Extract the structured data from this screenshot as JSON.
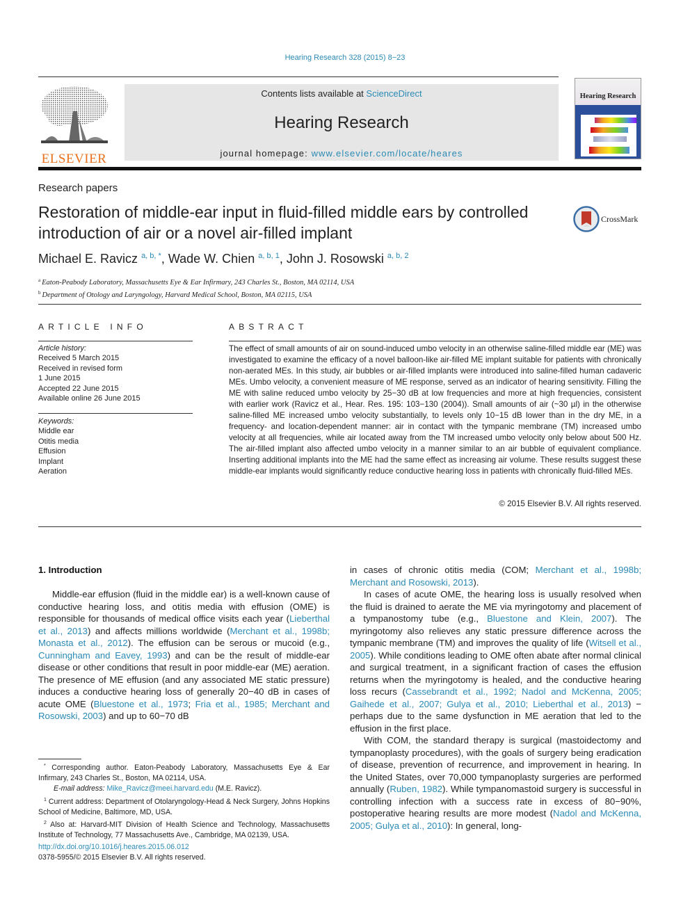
{
  "header": {
    "journal_ref": "Hearing Research 328 (2015) 8−23",
    "contents_prefix": "Contents lists available at ",
    "contents_link": "ScienceDirect",
    "journal_title": "Hearing Research",
    "homepage_prefix": "journal homepage: ",
    "homepage_link": "www.elsevier.com/locate/heares",
    "publisher_logo_text": "ELSEVIER",
    "cover_title": "Hearing Research",
    "crossmark_label": "CrossMark"
  },
  "colors": {
    "link": "#2a8ab5",
    "elsevier_orange": "#e9711c",
    "masthead_gray": "#e6e6e6"
  },
  "article": {
    "section": "Research papers",
    "title": "Restoration of middle-ear input in fluid-filled middle ears by controlled introduction of air or a novel air-filled implant",
    "authors": [
      {
        "name": "Michael E. Ravicz",
        "marks": "a, b, *"
      },
      {
        "name": "Wade W. Chien",
        "marks": "a, b, 1"
      },
      {
        "name": "John J. Rosowski",
        "marks": "a, b, 2"
      }
    ],
    "affiliations": [
      {
        "mark": "a",
        "text": "Eaton-Peabody Laboratory, Massachusetts Eye & Ear Infirmary, 243 Charles St., Boston, MA 02114, USA"
      },
      {
        "mark": "b",
        "text": "Department of Otology and Laryngology, Harvard Medical School, Boston, MA 02115, USA"
      }
    ]
  },
  "article_info": {
    "heading": "ARTICLE INFO",
    "history_label": "Article history:",
    "history": [
      "Received 5 March 2015",
      "Received in revised form",
      "1 June 2015",
      "Accepted 22 June 2015",
      "Available online 26 June 2015"
    ],
    "keywords_label": "Keywords:",
    "keywords": [
      "Middle ear",
      "Otitis media",
      "Effusion",
      "Implant",
      "Aeration"
    ]
  },
  "abstract": {
    "heading": "ABSTRACT",
    "text": "The effect of small amounts of air on sound-induced umbo velocity in an otherwise saline-filled middle ear (ME) was investigated to examine the efficacy of a novel balloon-like air-filled ME implant suitable for patients with chronically non-aerated MEs. In this study, air bubbles or air-filled implants were introduced into saline-filled human cadaveric MEs. Umbo velocity, a convenient measure of ME response, served as an indicator of hearing sensitivity. Filling the ME with saline reduced umbo velocity by 25−30 dB at low frequencies and more at high frequencies, consistent with earlier work (Ravicz et al., Hear. Res. 195: 103−130 (2004)). Small amounts of air (~30 µl) in the otherwise saline-filled ME increased umbo velocity substantially, to levels only 10−15 dB lower than in the dry ME, in a frequency- and location-dependent manner: air in contact with the tympanic membrane (TM) increased umbo velocity at all frequencies, while air located away from the TM increased umbo velocity only below about 500 Hz. The air-filled implant also affected umbo velocity in a manner similar to an air bubble of equivalent compliance. Inserting additional implants into the ME had the same effect as increasing air volume. These results suggest these middle-ear implants would significantly reduce conductive hearing loss in patients with chronically fluid-filled MEs.",
    "copyright": "© 2015 Elsevier B.V. All rights reserved."
  },
  "body": {
    "intro_heading": "1.  Introduction",
    "left": {
      "p1": [
        {
          "t": "Middle-ear effusion (fluid in the middle ear) is a well-known cause of conductive hearing loss, and otitis media with effusion (OME) is responsible for thousands of medical office visits each year ("
        },
        {
          "l": "Lieberthal et al., 2013"
        },
        {
          "t": ") and affects millions worldwide ("
        },
        {
          "l": "Merchant et al., 1998b; Monasta et al., 2012"
        },
        {
          "t": "). The effusion can be serous or mucoid (e.g., "
        },
        {
          "l": "Cunningham and Eavey, 1993"
        },
        {
          "t": ") and can be the result of middle-ear disease or other conditions that result in poor middle-ear (ME) aeration. The presence of ME effusion (and any associated ME static pressure) induces a conductive hearing loss of generally 20−40 dB in cases of acute OME ("
        },
        {
          "l": "Bluestone et al., 1973"
        },
        {
          "t": "; "
        },
        {
          "l": "Fria et al., 1985; Merchant and Rosowski, 2003"
        },
        {
          "t": ") and up to 60−70 dB"
        }
      ]
    },
    "right": {
      "p0": [
        {
          "t": "in cases of chronic otitis media (COM; "
        },
        {
          "l": "Merchant et al., 1998b; Merchant and Rosowski, 2013"
        },
        {
          "t": ")."
        }
      ],
      "p1": [
        {
          "t": "In cases of acute OME, the hearing loss is usually resolved when the fluid is drained to aerate the ME via myringotomy and placement of a tympanostomy tube (e.g., "
        },
        {
          "l": "Bluestone and Klein, 2007"
        },
        {
          "t": "). The myringotomy also relieves any static pressure difference across the tympanic membrane (TM) and improves the quality of life ("
        },
        {
          "l": "Witsell et al., 2005"
        },
        {
          "t": "). While conditions leading to OME often abate after normal clinical and surgical treatment, in a significant fraction of cases the effusion returns when the myringotomy is healed, and the conductive hearing loss recurs ("
        },
        {
          "l": "Cassebrandt et al., 1992; Nadol and McKenna, 2005; Gaihede et al., 2007; Gulya et al., 2010; Lieberthal et al., 2013"
        },
        {
          "t": ") − perhaps due to the same dysfunction in ME aeration that led to the effusion in the first place."
        }
      ],
      "p2": [
        {
          "t": "With COM, the standard therapy is surgical (mastoidectomy and tympanoplasty procedures), with the goals of surgery being eradication of disease, prevention of recurrence, and improvement in hearing. In the United States, over 70,000 tympanoplasty surgeries are performed annually ("
        },
        {
          "l": "Ruben, 1982"
        },
        {
          "t": "). While tympanomastoid surgery is successful in controlling infection with a success rate in excess of 80−90%, postoperative hearing results are more modest ("
        },
        {
          "l": "Nadol and McKenna, 2005; Gulya et al., 2010"
        },
        {
          "t": "): In general, long-"
        }
      ]
    }
  },
  "footnotes": {
    "corresponding_mark": "*",
    "corresponding": "Corresponding author. Eaton-Peabody Laboratory, Massachusetts Eye & Ear Infirmary, 243 Charles St., Boston, MA 02114, USA.",
    "email_label": "E-mail address:",
    "email": "Mike_Ravicz@meei.harvard.edu",
    "email_suffix": " (M.E. Ravicz).",
    "fn1_mark": "1",
    "fn1": "Current address: Department of Otolaryngology-Head & Neck Surgery, Johns Hopkins School of Medicine, Baltimore, MD, USA.",
    "fn2_mark": "2",
    "fn2": "Also at: Harvard-MIT Division of Health Science and Technology, Massachusetts Institute of Technology, 77 Massachusetts Ave., Cambridge, MA 02139, USA."
  },
  "doi": {
    "link": "http://dx.doi.org/10.1016/j.heares.2015.06.012",
    "issn_line": "0378-5955/© 2015 Elsevier B.V. All rights reserved."
  }
}
